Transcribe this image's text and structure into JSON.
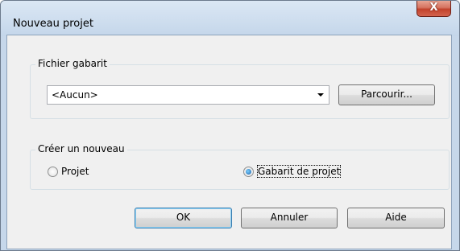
{
  "window": {
    "title": "Nouveau projet",
    "close_glyph": "X"
  },
  "template_group": {
    "label": "Fichier gabarit",
    "combo_value": "<Aucun>",
    "browse_label": "Parcourir..."
  },
  "create_group": {
    "label": "Créer un nouveau",
    "options": [
      {
        "label": "Projet",
        "checked": false
      },
      {
        "label": "Gabarit de projet",
        "checked": true
      }
    ]
  },
  "buttons": {
    "ok": "OK",
    "cancel": "Annuler",
    "help": "Aide"
  }
}
